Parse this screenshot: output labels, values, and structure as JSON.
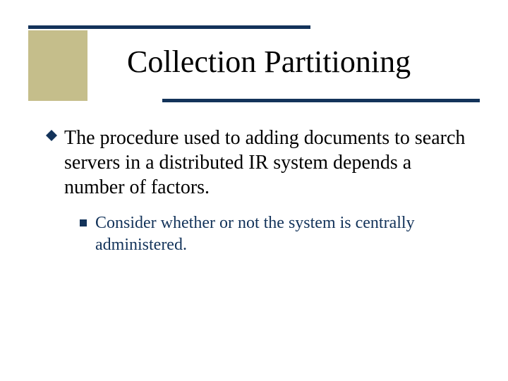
{
  "title": "Collection Partitioning",
  "bullets": {
    "level1": "The procedure used to adding documents to search servers in a distributed IR system depends a number of factors.",
    "level2": "Consider whether or not the system is centrally administered."
  },
  "colors": {
    "accent": "#13335a",
    "khaki": "#c5be8b"
  }
}
